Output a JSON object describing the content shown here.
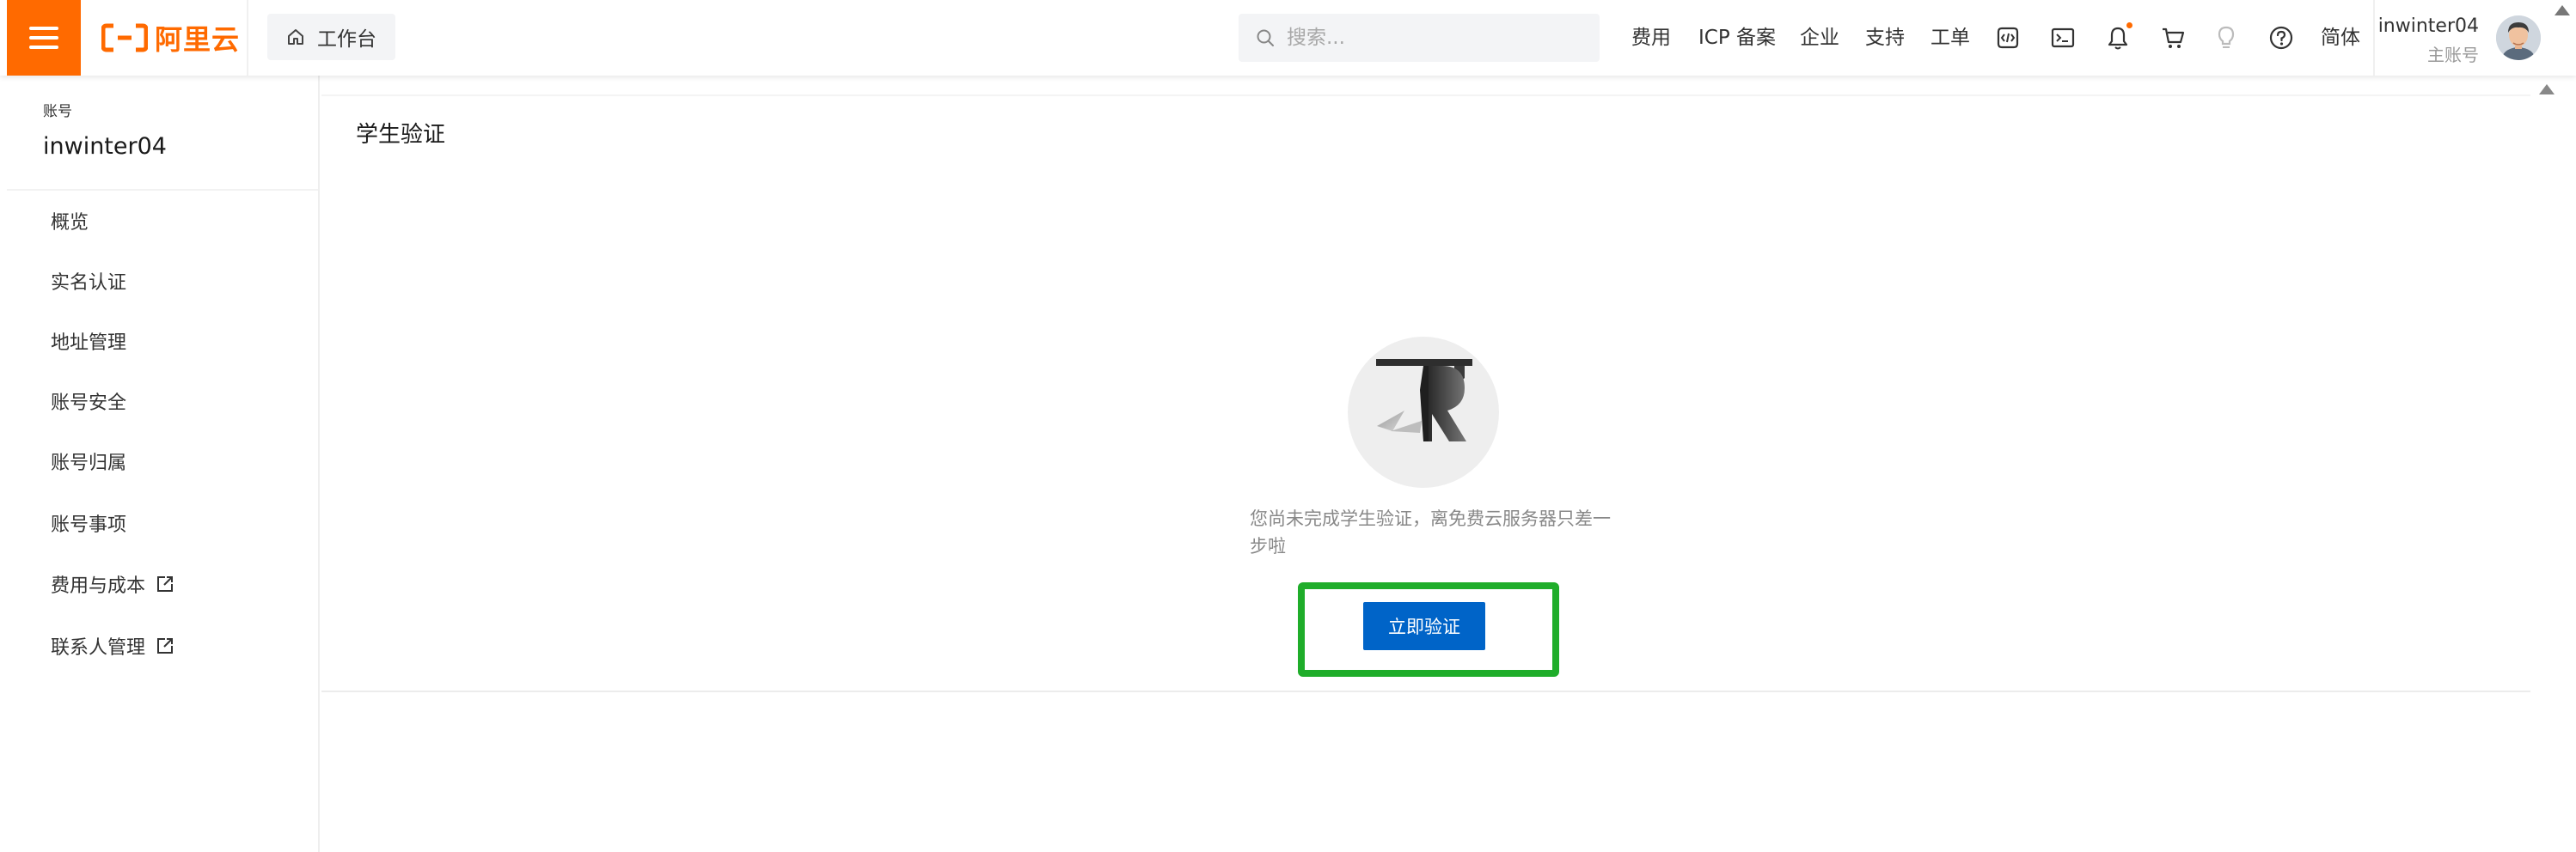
{
  "header": {
    "logo_text": "阿里云",
    "workbench_label": "工作台",
    "search_placeholder": "搜索...",
    "nav": [
      "费用",
      "ICP 备案",
      "企业",
      "支持",
      "工单"
    ],
    "language": "简体",
    "user": {
      "name": "inwinter04",
      "role": "主账号"
    },
    "icons": [
      "menu-icon",
      "home-icon",
      "search-icon",
      "code-icon",
      "terminal-icon",
      "bell-icon",
      "cart-icon",
      "bulb-icon",
      "help-icon"
    ]
  },
  "sidebar": {
    "account_label": "账号",
    "account_name": "inwinter04",
    "items": [
      {
        "label": "概览"
      },
      {
        "label": "实名认证"
      },
      {
        "label": "地址管理"
      },
      {
        "label": "账号安全"
      },
      {
        "label": "账号归属"
      },
      {
        "label": "账号事项"
      },
      {
        "label": "费用与成本",
        "external": true
      },
      {
        "label": "联系人管理",
        "external": true
      }
    ]
  },
  "main": {
    "title": "学生验证",
    "empty_message": "您尚未完成学生验证，离免费云服务器只差一步啦",
    "verify_button": "立即验证"
  },
  "colors": {
    "brand": "#ff6a00",
    "primary_button": "#0064c8",
    "highlight_box": "#1fad2a",
    "notification_dot": "#ff6a00"
  }
}
